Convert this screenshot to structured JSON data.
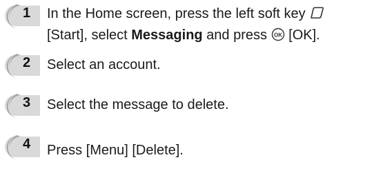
{
  "steps": [
    {
      "number": "1",
      "line1_text": "In the Home screen, press the left soft key",
      "line1_icon": "soft-key-icon",
      "line2_pre": "[Start], select ",
      "line2_bold": "Messaging",
      "line2_mid": " and press ",
      "line2_icon": "ok-key-icon",
      "line2_post": " [OK]."
    },
    {
      "number": "2",
      "text": "Select an account."
    },
    {
      "number": "3",
      "text": "Select the message to delete."
    },
    {
      "number": "4",
      "text": "Press [Menu] [Delete]."
    }
  ],
  "colors": {
    "badge_dark": "#8a8a8a",
    "badge_light": "#d6d6d6",
    "text": "#1a1a1a"
  }
}
